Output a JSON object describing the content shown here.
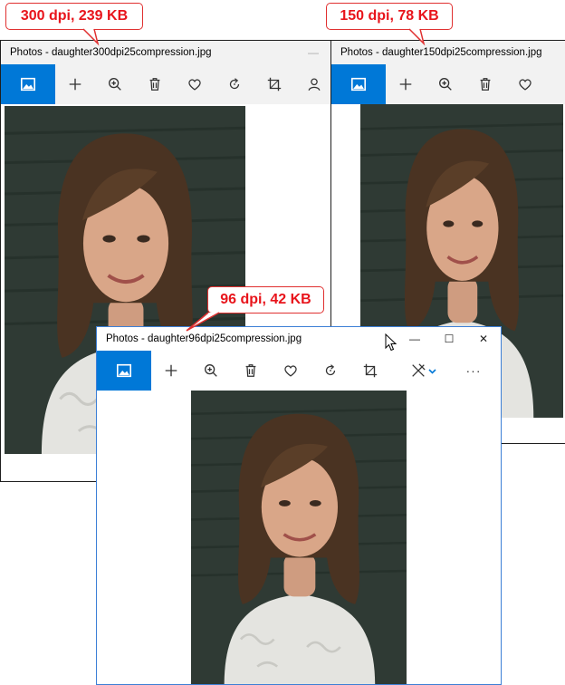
{
  "windows": {
    "w300": {
      "title": "Photos - daughter300dpi25compression.jpg"
    },
    "w150": {
      "title": "Photos - daughter150dpi25compression.jpg"
    },
    "w96": {
      "title": "Photos - daughter96dpi25compression.jpg"
    }
  },
  "callouts": {
    "c300": "300 dpi, 239 KB",
    "c150": "150 dpi, 78 KB",
    "c96": "96 dpi, 42 KB"
  },
  "window_controls": {
    "minimize": "—",
    "maximize": "☐",
    "close": "✕",
    "more": "···"
  },
  "colors": {
    "accent": "#0078d7",
    "callout_text": "#e8141b",
    "callout_border": "#e03030",
    "backdrop": "#2f3a34",
    "shirt": "#e4e4e0",
    "hair": "#4a3322",
    "skin": "#d9a688"
  },
  "toolbar_icons": [
    "photos-home-icon",
    "add-icon",
    "zoom-in-icon",
    "delete-icon",
    "favorite-icon",
    "rotate-icon",
    "crop-icon",
    "edit-draw-icon",
    "more-icon"
  ]
}
